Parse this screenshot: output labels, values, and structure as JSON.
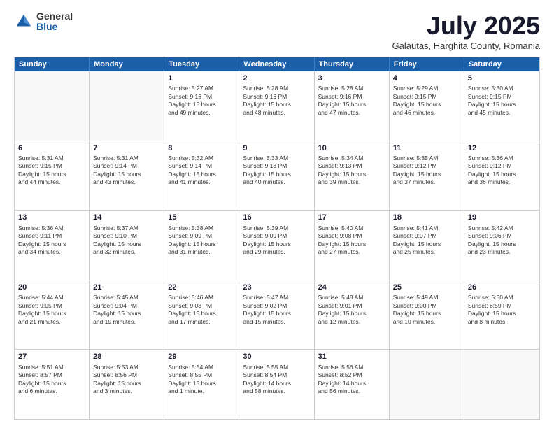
{
  "logo": {
    "general": "General",
    "blue": "Blue"
  },
  "title": "July 2025",
  "subtitle": "Galautas, Harghita County, Romania",
  "header_days": [
    "Sunday",
    "Monday",
    "Tuesday",
    "Wednesday",
    "Thursday",
    "Friday",
    "Saturday"
  ],
  "rows": [
    [
      {
        "day": "",
        "empty": true
      },
      {
        "day": "",
        "empty": true
      },
      {
        "day": "1",
        "line1": "Sunrise: 5:27 AM",
        "line2": "Sunset: 9:16 PM",
        "line3": "Daylight: 15 hours",
        "line4": "and 49 minutes."
      },
      {
        "day": "2",
        "line1": "Sunrise: 5:28 AM",
        "line2": "Sunset: 9:16 PM",
        "line3": "Daylight: 15 hours",
        "line4": "and 48 minutes."
      },
      {
        "day": "3",
        "line1": "Sunrise: 5:28 AM",
        "line2": "Sunset: 9:16 PM",
        "line3": "Daylight: 15 hours",
        "line4": "and 47 minutes."
      },
      {
        "day": "4",
        "line1": "Sunrise: 5:29 AM",
        "line2": "Sunset: 9:15 PM",
        "line3": "Daylight: 15 hours",
        "line4": "and 46 minutes."
      },
      {
        "day": "5",
        "line1": "Sunrise: 5:30 AM",
        "line2": "Sunset: 9:15 PM",
        "line3": "Daylight: 15 hours",
        "line4": "and 45 minutes."
      }
    ],
    [
      {
        "day": "6",
        "line1": "Sunrise: 5:31 AM",
        "line2": "Sunset: 9:15 PM",
        "line3": "Daylight: 15 hours",
        "line4": "and 44 minutes."
      },
      {
        "day": "7",
        "line1": "Sunrise: 5:31 AM",
        "line2": "Sunset: 9:14 PM",
        "line3": "Daylight: 15 hours",
        "line4": "and 43 minutes."
      },
      {
        "day": "8",
        "line1": "Sunrise: 5:32 AM",
        "line2": "Sunset: 9:14 PM",
        "line3": "Daylight: 15 hours",
        "line4": "and 41 minutes."
      },
      {
        "day": "9",
        "line1": "Sunrise: 5:33 AM",
        "line2": "Sunset: 9:13 PM",
        "line3": "Daylight: 15 hours",
        "line4": "and 40 minutes."
      },
      {
        "day": "10",
        "line1": "Sunrise: 5:34 AM",
        "line2": "Sunset: 9:13 PM",
        "line3": "Daylight: 15 hours",
        "line4": "and 39 minutes."
      },
      {
        "day": "11",
        "line1": "Sunrise: 5:35 AM",
        "line2": "Sunset: 9:12 PM",
        "line3": "Daylight: 15 hours",
        "line4": "and 37 minutes."
      },
      {
        "day": "12",
        "line1": "Sunrise: 5:36 AM",
        "line2": "Sunset: 9:12 PM",
        "line3": "Daylight: 15 hours",
        "line4": "and 36 minutes."
      }
    ],
    [
      {
        "day": "13",
        "line1": "Sunrise: 5:36 AM",
        "line2": "Sunset: 9:11 PM",
        "line3": "Daylight: 15 hours",
        "line4": "and 34 minutes."
      },
      {
        "day": "14",
        "line1": "Sunrise: 5:37 AM",
        "line2": "Sunset: 9:10 PM",
        "line3": "Daylight: 15 hours",
        "line4": "and 32 minutes."
      },
      {
        "day": "15",
        "line1": "Sunrise: 5:38 AM",
        "line2": "Sunset: 9:09 PM",
        "line3": "Daylight: 15 hours",
        "line4": "and 31 minutes."
      },
      {
        "day": "16",
        "line1": "Sunrise: 5:39 AM",
        "line2": "Sunset: 9:09 PM",
        "line3": "Daylight: 15 hours",
        "line4": "and 29 minutes."
      },
      {
        "day": "17",
        "line1": "Sunrise: 5:40 AM",
        "line2": "Sunset: 9:08 PM",
        "line3": "Daylight: 15 hours",
        "line4": "and 27 minutes."
      },
      {
        "day": "18",
        "line1": "Sunrise: 5:41 AM",
        "line2": "Sunset: 9:07 PM",
        "line3": "Daylight: 15 hours",
        "line4": "and 25 minutes."
      },
      {
        "day": "19",
        "line1": "Sunrise: 5:42 AM",
        "line2": "Sunset: 9:06 PM",
        "line3": "Daylight: 15 hours",
        "line4": "and 23 minutes."
      }
    ],
    [
      {
        "day": "20",
        "line1": "Sunrise: 5:44 AM",
        "line2": "Sunset: 9:05 PM",
        "line3": "Daylight: 15 hours",
        "line4": "and 21 minutes."
      },
      {
        "day": "21",
        "line1": "Sunrise: 5:45 AM",
        "line2": "Sunset: 9:04 PM",
        "line3": "Daylight: 15 hours",
        "line4": "and 19 minutes."
      },
      {
        "day": "22",
        "line1": "Sunrise: 5:46 AM",
        "line2": "Sunset: 9:03 PM",
        "line3": "Daylight: 15 hours",
        "line4": "and 17 minutes."
      },
      {
        "day": "23",
        "line1": "Sunrise: 5:47 AM",
        "line2": "Sunset: 9:02 PM",
        "line3": "Daylight: 15 hours",
        "line4": "and 15 minutes."
      },
      {
        "day": "24",
        "line1": "Sunrise: 5:48 AM",
        "line2": "Sunset: 9:01 PM",
        "line3": "Daylight: 15 hours",
        "line4": "and 12 minutes."
      },
      {
        "day": "25",
        "line1": "Sunrise: 5:49 AM",
        "line2": "Sunset: 9:00 PM",
        "line3": "Daylight: 15 hours",
        "line4": "and 10 minutes."
      },
      {
        "day": "26",
        "line1": "Sunrise: 5:50 AM",
        "line2": "Sunset: 8:59 PM",
        "line3": "Daylight: 15 hours",
        "line4": "and 8 minutes."
      }
    ],
    [
      {
        "day": "27",
        "line1": "Sunrise: 5:51 AM",
        "line2": "Sunset: 8:57 PM",
        "line3": "Daylight: 15 hours",
        "line4": "and 6 minutes."
      },
      {
        "day": "28",
        "line1": "Sunrise: 5:53 AM",
        "line2": "Sunset: 8:56 PM",
        "line3": "Daylight: 15 hours",
        "line4": "and 3 minutes."
      },
      {
        "day": "29",
        "line1": "Sunrise: 5:54 AM",
        "line2": "Sunset: 8:55 PM",
        "line3": "Daylight: 15 hours",
        "line4": "and 1 minute."
      },
      {
        "day": "30",
        "line1": "Sunrise: 5:55 AM",
        "line2": "Sunset: 8:54 PM",
        "line3": "Daylight: 14 hours",
        "line4": "and 58 minutes."
      },
      {
        "day": "31",
        "line1": "Sunrise: 5:56 AM",
        "line2": "Sunset: 8:52 PM",
        "line3": "Daylight: 14 hours",
        "line4": "and 56 minutes."
      },
      {
        "day": "",
        "empty": true
      },
      {
        "day": "",
        "empty": true
      }
    ]
  ]
}
